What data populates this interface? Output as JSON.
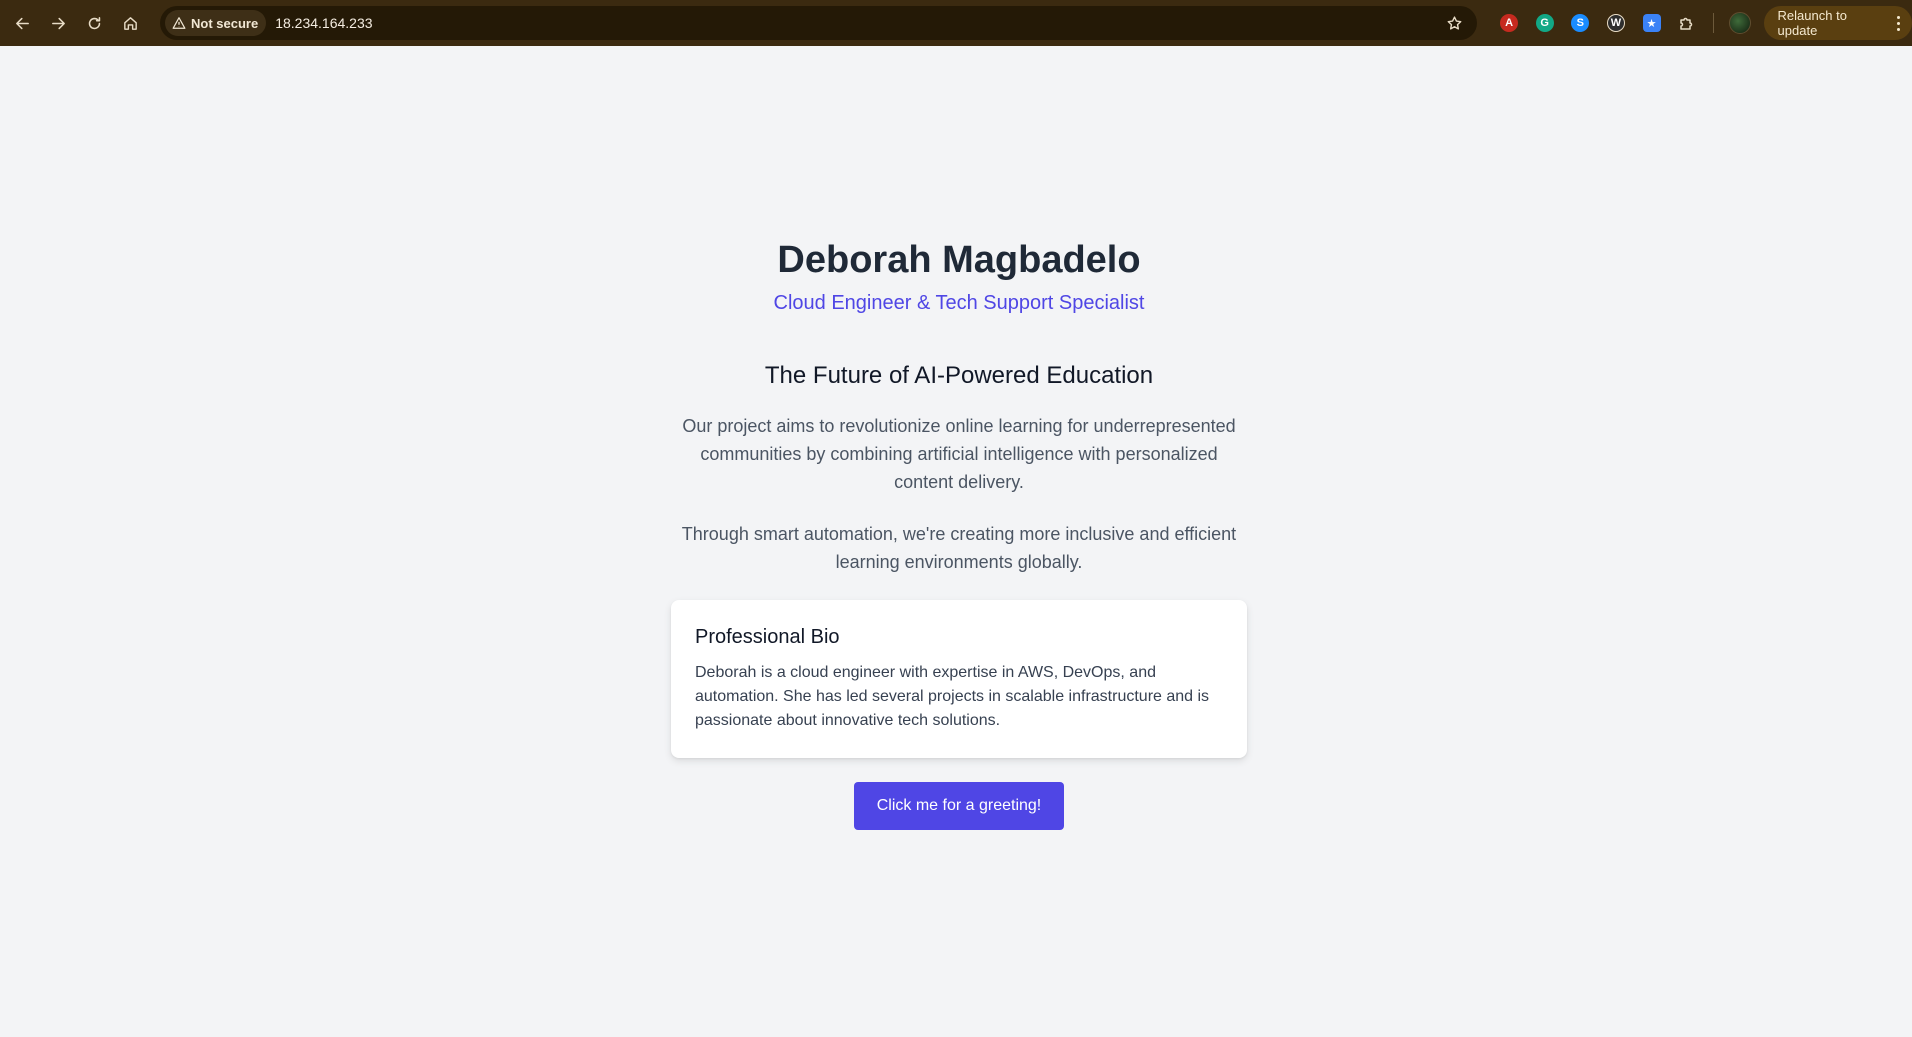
{
  "browser": {
    "security_label": "Not secure",
    "url": "18.234.164.233",
    "relaunch_label": "Relaunch to update",
    "extensions": [
      {
        "name": "pdf-extension-icon",
        "color": "#d4271f",
        "glyph": "A"
      },
      {
        "name": "grammarly-extension-icon",
        "color": "#15c39a",
        "glyph": "G"
      },
      {
        "name": "shazam-extension-icon",
        "color": "#1a8cff",
        "glyph": "S"
      },
      {
        "name": "wordtune-extension-icon",
        "color": "#2b2b2b",
        "glyph": "W"
      },
      {
        "name": "tab-manager-extension-icon",
        "color": "#3b82f6",
        "glyph": "★"
      }
    ]
  },
  "page": {
    "name": "Deborah Magbadelo",
    "role": "Cloud Engineer & Tech Support Specialist",
    "headline": "The Future of AI-Powered Education",
    "paragraph_1": "Our project aims to revolutionize online learning for underrepresented communities by combining artificial intelligence with personalized content delivery.",
    "paragraph_2": "Through smart automation, we're creating more inclusive and efficient learning environments globally.",
    "bio": {
      "title": "Professional Bio",
      "text": "Deborah is a cloud engineer with expertise in AWS, DevOps, and automation. She has led several projects in scalable infrastructure and is passionate about innovative tech solutions."
    },
    "button_label": "Click me for a greeting!"
  },
  "colors": {
    "accent": "#4f46e5",
    "page_background": "#f3f4f6",
    "chrome_background": "#3b2a10"
  }
}
